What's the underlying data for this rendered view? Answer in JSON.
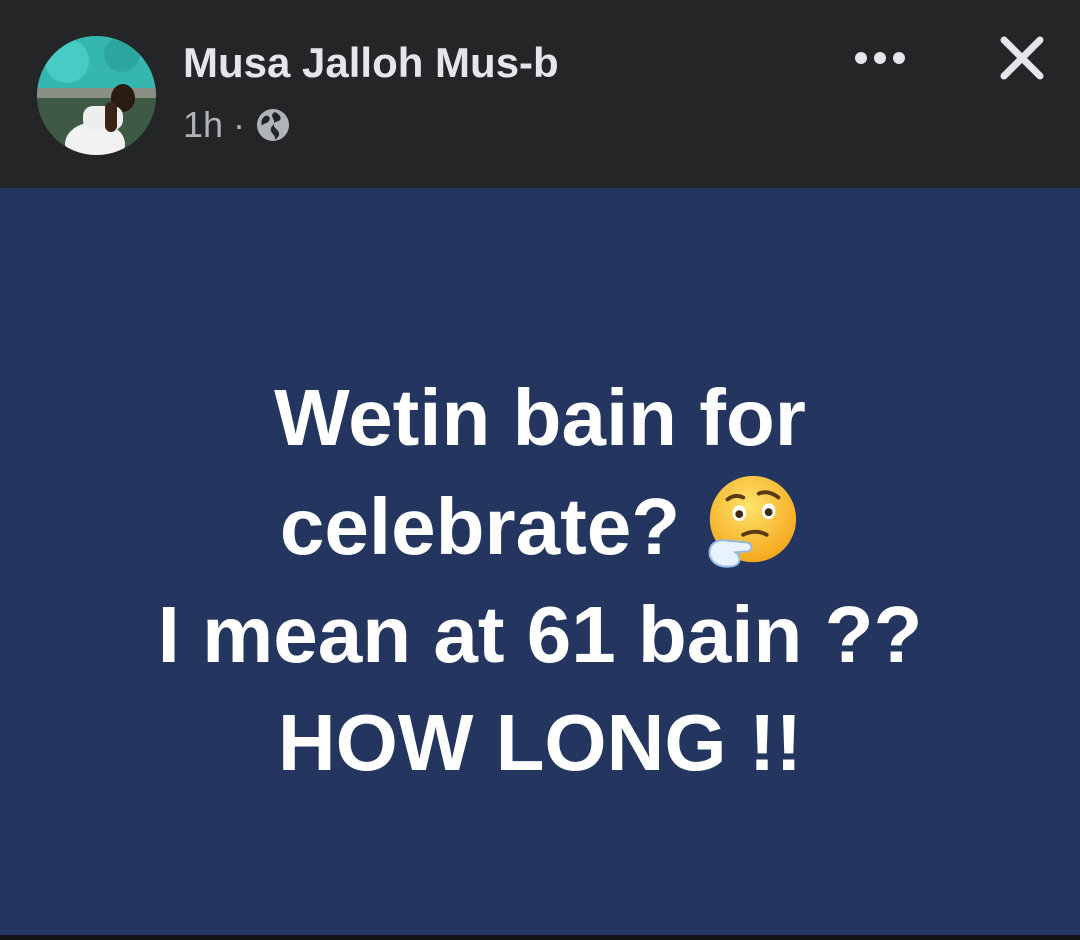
{
  "header": {
    "author_name": "Musa Jalloh Mus-b",
    "timestamp": "1h",
    "separator": "·",
    "privacy_icon": "globe-icon",
    "more_icon": "more-options-icon",
    "close_icon": "close-icon"
  },
  "post": {
    "background_color": "#24365f",
    "text_color": "#ffffff",
    "lines": [
      "Wetin bain for",
      "celebrate?",
      "I mean at 61 bain ??",
      "HOW LONG !!"
    ],
    "emoji": "thinking-face-icon"
  },
  "colors": {
    "header_bg": "#242526",
    "name_text": "#e4e6eb",
    "meta_text": "#b0b3b8"
  }
}
